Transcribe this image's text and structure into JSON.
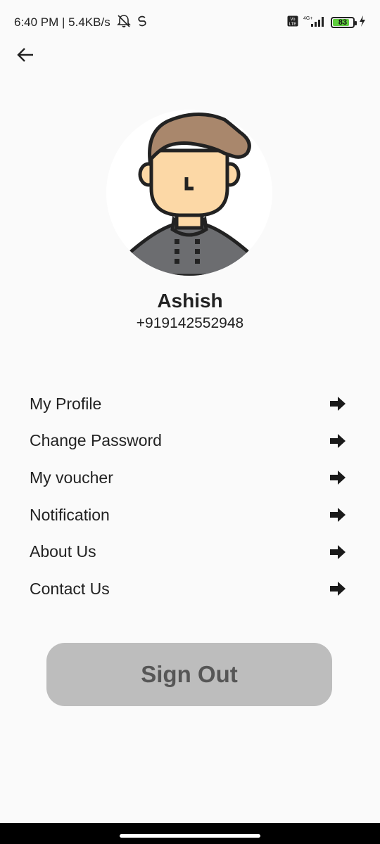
{
  "status_bar": {
    "time_speed": "6:40 PM | 5.4KB/s",
    "network": "4G+",
    "volte": "Vo LTE",
    "battery_level": "83",
    "battery_fraction": 0.83
  },
  "profile": {
    "name": "Ashish",
    "phone": "+919142552948"
  },
  "menu": {
    "items": [
      {
        "label": "My Profile"
      },
      {
        "label": "Change Password"
      },
      {
        "label": "My voucher"
      },
      {
        "label": "Notification"
      },
      {
        "label": "About Us"
      },
      {
        "label": "Contact Us"
      }
    ]
  },
  "sign_out_label": "Sign Out",
  "colors": {
    "background": "#fafafa",
    "button": "#bdbdbd",
    "button_text": "#565656",
    "battery": "#5fce3e"
  }
}
